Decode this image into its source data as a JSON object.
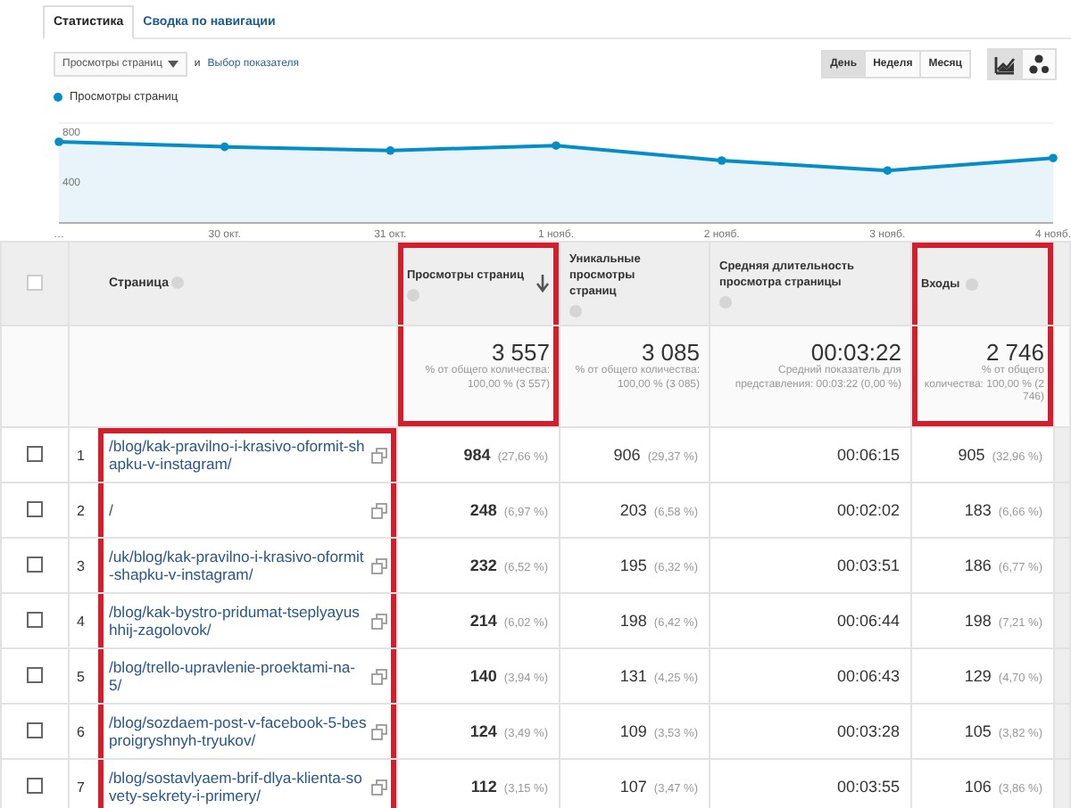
{
  "tabs": [
    {
      "label": "Статистика",
      "selected": true
    },
    {
      "label": "Сводка по навигации",
      "selected": false
    }
  ],
  "toolbar": {
    "metric_select": "Просмотры страниц",
    "conjunction": "и",
    "add_metric_link": "Выбор показателя",
    "periods": [
      {
        "label": "День",
        "selected": true
      },
      {
        "label": "Неделя",
        "selected": false
      },
      {
        "label": "Месяц",
        "selected": false
      }
    ],
    "view_buttons": [
      {
        "kind": "line",
        "selected": true
      },
      {
        "kind": "bubbles",
        "selected": false
      }
    ]
  },
  "chart": {
    "chart_data": {
      "type": "area",
      "categories": [
        "…",
        "30 окт.",
        "31 окт.",
        "1 нояб.",
        "2 нояб.",
        "3 нояб.",
        "4 нояб."
      ],
      "series": [
        {
          "name": "Просмотры страниц",
          "color": "#058dc7",
          "values": [
            650,
            610,
            580,
            620,
            500,
            420,
            520
          ]
        }
      ],
      "yticks": [
        400,
        800
      ],
      "ylim": [
        0,
        800
      ]
    }
  },
  "table": {
    "page_links_highlighted": true,
    "select_all": {
      "checked": false
    },
    "page_column": {
      "label": "Страница"
    },
    "columns": [
      {
        "label": "Просмотры страниц",
        "sorted": true,
        "highlighted": true
      },
      {
        "label": "Уникальные просмотры страниц",
        "sorted": false,
        "highlighted": false
      },
      {
        "label": "Средняя длительность просмотра страницы",
        "sorted": false,
        "highlighted": false
      },
      {
        "label": "Входы",
        "sorted": false,
        "highlighted": true
      }
    ],
    "summary": [
      {
        "value": "3 557",
        "note": "% от общего количества: 100,00 % (3 557)"
      },
      {
        "value": "3 085",
        "note": "% от общего количества: 100,00 % (3 085)"
      },
      {
        "value": "00:03:22",
        "note": "Средний показатель для представления: 00:03:22 (0,00 %)"
      },
      {
        "value": "2 746",
        "note": "% от общего количества: 100,00 % (2 746)"
      }
    ],
    "rows": [
      {
        "index": "1",
        "page": "/blog/kak-pravilno-i-krasivo-oformit-shapku-v-instagram/",
        "checked": false,
        "cells": [
          {
            "value": "984",
            "pct": "(27,66 %)"
          },
          {
            "value": "906",
            "pct": "(29,37 %)"
          },
          {
            "value": "00:06:15"
          },
          {
            "value": "905",
            "pct": "(32,96 %)"
          }
        ]
      },
      {
        "index": "2",
        "page": "/",
        "checked": false,
        "cells": [
          {
            "value": "248",
            "pct": "(6,97 %)"
          },
          {
            "value": "203",
            "pct": "(6,58 %)"
          },
          {
            "value": "00:02:02"
          },
          {
            "value": "183",
            "pct": "(6,66 %)"
          }
        ]
      },
      {
        "index": "3",
        "page": "/uk/blog/kak-pravilno-i-krasivo-oformit-shapku-v-instagram/",
        "checked": false,
        "cells": [
          {
            "value": "232",
            "pct": "(6,52 %)"
          },
          {
            "value": "195",
            "pct": "(6,32 %)"
          },
          {
            "value": "00:03:51"
          },
          {
            "value": "186",
            "pct": "(6,77 %)"
          }
        ]
      },
      {
        "index": "4",
        "page": "/blog/kak-bystro-pridumat-tseplyayushhij-zagolovok/",
        "checked": false,
        "cells": [
          {
            "value": "214",
            "pct": "(6,02 %)"
          },
          {
            "value": "198",
            "pct": "(6,42 %)"
          },
          {
            "value": "00:06:44"
          },
          {
            "value": "198",
            "pct": "(7,21 %)"
          }
        ]
      },
      {
        "index": "5",
        "page": "/blog/trello-upravlenie-proektami-na-5/",
        "checked": false,
        "cells": [
          {
            "value": "140",
            "pct": "(3,94 %)"
          },
          {
            "value": "131",
            "pct": "(4,25 %)"
          },
          {
            "value": "00:06:43"
          },
          {
            "value": "129",
            "pct": "(4,70 %)"
          }
        ]
      },
      {
        "index": "6",
        "page": "/blog/sozdaem-post-v-facebook-5-besproigryshnyh-tryukov/",
        "checked": false,
        "cells": [
          {
            "value": "124",
            "pct": "(3,49 %)"
          },
          {
            "value": "109",
            "pct": "(3,53 %)"
          },
          {
            "value": "00:03:28"
          },
          {
            "value": "105",
            "pct": "(3,82 %)"
          }
        ]
      },
      {
        "index": "7",
        "page": "/blog/sostavlyaem-brif-dlya-klienta-sovety-sekrety-i-primery/",
        "checked": false,
        "cells": [
          {
            "value": "112",
            "pct": "(3,15 %)"
          },
          {
            "value": "107",
            "pct": "(3,47 %)"
          },
          {
            "value": "00:03:55"
          },
          {
            "value": "106",
            "pct": "(3,86 %)"
          }
        ]
      }
    ]
  }
}
